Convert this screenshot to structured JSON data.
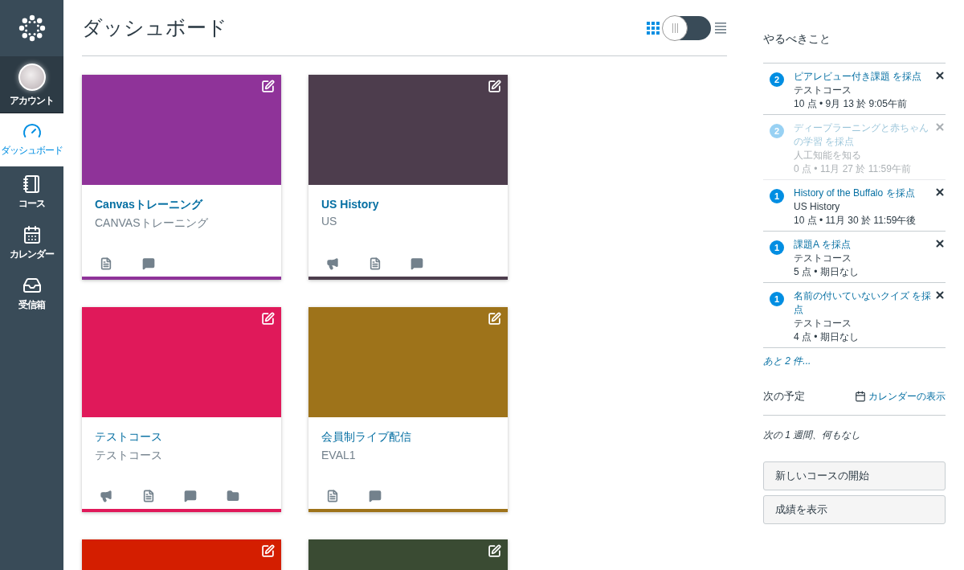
{
  "nav": [
    {
      "kind": "account",
      "label": "アカウント",
      "selected": false
    },
    {
      "kind": "dashboard",
      "label": "ダッシュボード",
      "selected": true
    },
    {
      "kind": "courses",
      "label": "コース",
      "selected": false
    },
    {
      "kind": "calendar",
      "label": "カレンダー",
      "selected": false
    },
    {
      "kind": "inbox",
      "label": "受信箱",
      "selected": false
    }
  ],
  "title": "ダッシュボード",
  "view_toggle": {
    "card_view_selected": true,
    "on": false
  },
  "cards": [
    {
      "color": "#8f3399",
      "name": "Canvasトレーニング",
      "code": "CANVASトレーニング",
      "links": [
        {
          "kind": "assignments"
        },
        {
          "kind": "discussions"
        }
      ]
    },
    {
      "color": "#4d3d4d",
      "name": "US History",
      "code": "US",
      "links": [
        {
          "kind": "announcements"
        },
        {
          "kind": "assignments"
        },
        {
          "kind": "discussions"
        }
      ]
    },
    {
      "color": "#e0195a",
      "name": "テストコース",
      "code": "テストコース",
      "links": [
        {
          "kind": "announcements"
        },
        {
          "kind": "assignments"
        },
        {
          "kind": "discussions"
        },
        {
          "kind": "files"
        }
      ]
    },
    {
      "color": "#9e731a",
      "name": "会員制ライブ配信",
      "code": "EVAL1",
      "links": [
        {
          "kind": "assignments"
        },
        {
          "kind": "discussions"
        }
      ]
    },
    {
      "color": "#d41e00"
    },
    {
      "color": "#3a4b33"
    }
  ],
  "todo": {
    "title": "やるべきこと",
    "items": [
      {
        "count": "2",
        "title": "ピアレビュー付き課題 を採点",
        "course": "テストコース",
        "meta": "10 点 • 9月 13 於 9:05午前",
        "muted": false
      },
      {
        "count": "2",
        "title": "ディープラーニングと赤ちゃんの学習 を採点",
        "course": "人工知能を知る",
        "meta": "0 点 • 11月 27 於 11:59午前",
        "muted": true
      },
      {
        "count": "1",
        "title": "History of the Buffalo を採点",
        "course": "US History",
        "meta": "10 点 • 11月 30 於 11:59午後",
        "muted": false
      },
      {
        "count": "1",
        "title": "課題A を採点",
        "course": "テストコース",
        "meta": "5 点 • 期日なし",
        "muted": false
      },
      {
        "count": "1",
        "title": "名前の付いていないクイズ を採点",
        "course": "テストコース",
        "meta": "4 点 • 期日なし",
        "muted": false
      }
    ],
    "more": "あと 2 件..."
  },
  "upcoming": {
    "title": "次の予定",
    "calendar_link": "カレンダーの表示",
    "empty": "次の 1 週間、何もなし"
  },
  "buttons": [
    "新しいコースの開始",
    "成績を表示"
  ]
}
